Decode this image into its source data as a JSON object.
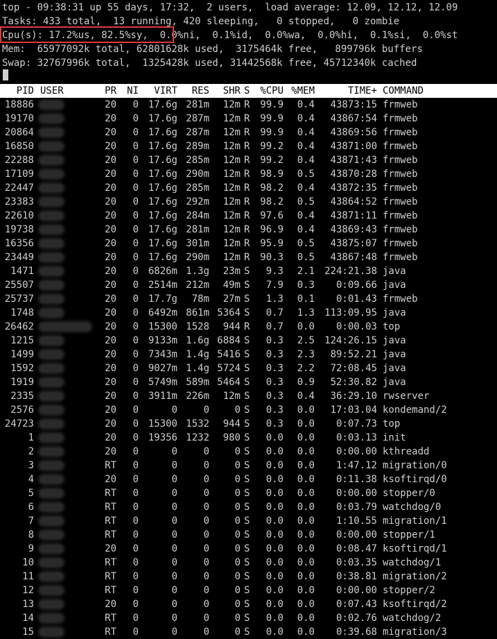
{
  "summary": {
    "line1": "top - 09:38:31 up 55 days, 17:32,  2 users,  load average: 12.09, 12.12, 12.09",
    "line2": "Tasks: 433 total,  13 running, 420 sleeping,   0 stopped,   0 zombie",
    "line3": "Cpu(s): 17.2%us, 82.5%sy,  0.0%ni,  0.1%id,  0.0%wa,  0.0%hi,  0.1%si,  0.0%st",
    "line4": "Mem:  65977092k total, 62801628k used,  3175464k free,   899796k buffers",
    "line5": "Swap: 32767996k total,  1325428k used, 31442568k free, 45712340k cached"
  },
  "columns": {
    "pid": "PID",
    "user": "USER",
    "pr": "PR",
    "ni": "NI",
    "virt": "VIRT",
    "res": "RES",
    "shr": "SHR",
    "s": "S",
    "cpu": "%CPU",
    "mem": "%MEM",
    "time": "TIME+",
    "command": "COMMAND"
  },
  "processes": [
    {
      "pid": "18886",
      "pr": "20",
      "ni": "0",
      "virt": "17.6g",
      "res": "281m",
      "shr": "12m",
      "s": "R",
      "cpu": "99.9",
      "mem": "0.4",
      "time": "43873:15",
      "command": "frmweb"
    },
    {
      "pid": "19170",
      "pr": "20",
      "ni": "0",
      "virt": "17.6g",
      "res": "287m",
      "shr": "12m",
      "s": "R",
      "cpu": "99.9",
      "mem": "0.4",
      "time": "43867:54",
      "command": "frmweb"
    },
    {
      "pid": "20864",
      "pr": "20",
      "ni": "0",
      "virt": "17.6g",
      "res": "287m",
      "shr": "12m",
      "s": "R",
      "cpu": "99.9",
      "mem": "0.4",
      "time": "43869:56",
      "command": "frmweb"
    },
    {
      "pid": "16850",
      "pr": "20",
      "ni": "0",
      "virt": "17.6g",
      "res": "289m",
      "shr": "12m",
      "s": "R",
      "cpu": "99.2",
      "mem": "0.4",
      "time": "43871:00",
      "command": "frmweb"
    },
    {
      "pid": "22288",
      "pr": "20",
      "ni": "0",
      "virt": "17.6g",
      "res": "285m",
      "shr": "12m",
      "s": "R",
      "cpu": "99.2",
      "mem": "0.4",
      "time": "43871:43",
      "command": "frmweb"
    },
    {
      "pid": "17109",
      "pr": "20",
      "ni": "0",
      "virt": "17.6g",
      "res": "290m",
      "shr": "12m",
      "s": "R",
      "cpu": "98.9",
      "mem": "0.5",
      "time": "43870:28",
      "command": "frmweb"
    },
    {
      "pid": "22447",
      "pr": "20",
      "ni": "0",
      "virt": "17.6g",
      "res": "285m",
      "shr": "12m",
      "s": "R",
      "cpu": "98.2",
      "mem": "0.4",
      "time": "43872:35",
      "command": "frmweb"
    },
    {
      "pid": "23383",
      "pr": "20",
      "ni": "0",
      "virt": "17.6g",
      "res": "292m",
      "shr": "12m",
      "s": "R",
      "cpu": "98.2",
      "mem": "0.5",
      "time": "43864:52",
      "command": "frmweb"
    },
    {
      "pid": "22610",
      "pr": "20",
      "ni": "0",
      "virt": "17.6g",
      "res": "284m",
      "shr": "12m",
      "s": "R",
      "cpu": "97.6",
      "mem": "0.4",
      "time": "43871:11",
      "command": "frmweb"
    },
    {
      "pid": "19738",
      "pr": "20",
      "ni": "0",
      "virt": "17.6g",
      "res": "281m",
      "shr": "12m",
      "s": "R",
      "cpu": "96.9",
      "mem": "0.4",
      "time": "43869:43",
      "command": "frmweb"
    },
    {
      "pid": "16356",
      "pr": "20",
      "ni": "0",
      "virt": "17.6g",
      "res": "301m",
      "shr": "12m",
      "s": "R",
      "cpu": "95.9",
      "mem": "0.5",
      "time": "43875:07",
      "command": "frmweb"
    },
    {
      "pid": "23449",
      "pr": "20",
      "ni": "0",
      "virt": "17.6g",
      "res": "290m",
      "shr": "12m",
      "s": "R",
      "cpu": "90.3",
      "mem": "0.5",
      "time": "43867:48",
      "command": "frmweb"
    },
    {
      "pid": "1471",
      "pr": "20",
      "ni": "0",
      "virt": "6826m",
      "res": "1.3g",
      "shr": "23m",
      "s": "S",
      "cpu": "9.3",
      "mem": "2.1",
      "time": "224:21.38",
      "command": "java"
    },
    {
      "pid": "25507",
      "pr": "20",
      "ni": "0",
      "virt": "2514m",
      "res": "212m",
      "shr": "49m",
      "s": "S",
      "cpu": "7.9",
      "mem": "0.3",
      "time": "0:09.66",
      "command": "java"
    },
    {
      "pid": "25737",
      "pr": "20",
      "ni": "0",
      "virt": "17.7g",
      "res": "78m",
      "shr": "27m",
      "s": "S",
      "cpu": "1.3",
      "mem": "0.1",
      "time": "0:01.43",
      "command": "frmweb"
    },
    {
      "pid": "1748",
      "pr": "20",
      "ni": "0",
      "virt": "6492m",
      "res": "861m",
      "shr": "5364",
      "s": "S",
      "cpu": "0.7",
      "mem": "1.3",
      "time": "113:09.95",
      "command": "java"
    },
    {
      "pid": "26462",
      "pr": "20",
      "ni": "0",
      "virt": "15300",
      "res": "1528",
      "shr": "944",
      "s": "R",
      "cpu": "0.7",
      "mem": "0.0",
      "time": "0:00.03",
      "command": "top"
    },
    {
      "pid": "1215",
      "pr": "20",
      "ni": "0",
      "virt": "9133m",
      "res": "1.6g",
      "shr": "6884",
      "s": "S",
      "cpu": "0.3",
      "mem": "2.5",
      "time": "124:26.15",
      "command": "java"
    },
    {
      "pid": "1499",
      "pr": "20",
      "ni": "0",
      "virt": "7343m",
      "res": "1.4g",
      "shr": "5416",
      "s": "S",
      "cpu": "0.3",
      "mem": "2.3",
      "time": "89:52.21",
      "command": "java"
    },
    {
      "pid": "1592",
      "pr": "20",
      "ni": "0",
      "virt": "9027m",
      "res": "1.4g",
      "shr": "5724",
      "s": "S",
      "cpu": "0.3",
      "mem": "2.2",
      "time": "72:08.45",
      "command": "java"
    },
    {
      "pid": "1919",
      "pr": "20",
      "ni": "0",
      "virt": "5749m",
      "res": "589m",
      "shr": "5464",
      "s": "S",
      "cpu": "0.3",
      "mem": "0.9",
      "time": "52:30.82",
      "command": "java"
    },
    {
      "pid": "2335",
      "pr": "20",
      "ni": "0",
      "virt": "3911m",
      "res": "226m",
      "shr": "12m",
      "s": "S",
      "cpu": "0.3",
      "mem": "0.4",
      "time": "36:29.10",
      "command": "rwserver"
    },
    {
      "pid": "2576",
      "pr": "20",
      "ni": "0",
      "virt": "0",
      "res": "0",
      "shr": "0",
      "s": "S",
      "cpu": "0.3",
      "mem": "0.0",
      "time": "17:03.04",
      "command": "kondemand/2"
    },
    {
      "pid": "24723",
      "pr": "20",
      "ni": "0",
      "virt": "15300",
      "res": "1532",
      "shr": "944",
      "s": "S",
      "cpu": "0.3",
      "mem": "0.0",
      "time": "0:07.73",
      "command": "top"
    },
    {
      "pid": "1",
      "pr": "20",
      "ni": "0",
      "virt": "19356",
      "res": "1232",
      "shr": "980",
      "s": "S",
      "cpu": "0.0",
      "mem": "0.0",
      "time": "0:03.13",
      "command": "init"
    },
    {
      "pid": "2",
      "pr": "20",
      "ni": "0",
      "virt": "0",
      "res": "0",
      "shr": "0",
      "s": "S",
      "cpu": "0.0",
      "mem": "0.0",
      "time": "0:00.00",
      "command": "kthreadd"
    },
    {
      "pid": "3",
      "pr": "RT",
      "ni": "0",
      "virt": "0",
      "res": "0",
      "shr": "0",
      "s": "S",
      "cpu": "0.0",
      "mem": "0.0",
      "time": "1:47.12",
      "command": "migration/0"
    },
    {
      "pid": "4",
      "pr": "20",
      "ni": "0",
      "virt": "0",
      "res": "0",
      "shr": "0",
      "s": "S",
      "cpu": "0.0",
      "mem": "0.0",
      "time": "0:11.38",
      "command": "ksoftirqd/0"
    },
    {
      "pid": "5",
      "pr": "RT",
      "ni": "0",
      "virt": "0",
      "res": "0",
      "shr": "0",
      "s": "S",
      "cpu": "0.0",
      "mem": "0.0",
      "time": "0:00.00",
      "command": "stopper/0"
    },
    {
      "pid": "6",
      "pr": "RT",
      "ni": "0",
      "virt": "0",
      "res": "0",
      "shr": "0",
      "s": "S",
      "cpu": "0.0",
      "mem": "0.0",
      "time": "0:03.79",
      "command": "watchdog/0"
    },
    {
      "pid": "7",
      "pr": "RT",
      "ni": "0",
      "virt": "0",
      "res": "0",
      "shr": "0",
      "s": "S",
      "cpu": "0.0",
      "mem": "0.0",
      "time": "1:10.55",
      "command": "migration/1"
    },
    {
      "pid": "8",
      "pr": "RT",
      "ni": "0",
      "virt": "0",
      "res": "0",
      "shr": "0",
      "s": "S",
      "cpu": "0.0",
      "mem": "0.0",
      "time": "0:00.00",
      "command": "stopper/1"
    },
    {
      "pid": "9",
      "pr": "20",
      "ni": "0",
      "virt": "0",
      "res": "0",
      "shr": "0",
      "s": "S",
      "cpu": "0.0",
      "mem": "0.0",
      "time": "0:08.47",
      "command": "ksoftirqd/1"
    },
    {
      "pid": "10",
      "pr": "RT",
      "ni": "0",
      "virt": "0",
      "res": "0",
      "shr": "0",
      "s": "S",
      "cpu": "0.0",
      "mem": "0.0",
      "time": "0:03.35",
      "command": "watchdog/1"
    },
    {
      "pid": "11",
      "pr": "RT",
      "ni": "0",
      "virt": "0",
      "res": "0",
      "shr": "0",
      "s": "S",
      "cpu": "0.0",
      "mem": "0.0",
      "time": "0:38.81",
      "command": "migration/2"
    },
    {
      "pid": "12",
      "pr": "RT",
      "ni": "0",
      "virt": "0",
      "res": "0",
      "shr": "0",
      "s": "S",
      "cpu": "0.0",
      "mem": "0.0",
      "time": "0:00.00",
      "command": "stopper/2"
    },
    {
      "pid": "13",
      "pr": "20",
      "ni": "0",
      "virt": "0",
      "res": "0",
      "shr": "0",
      "s": "S",
      "cpu": "0.0",
      "mem": "0.0",
      "time": "0:07.43",
      "command": "ksoftirqd/2"
    },
    {
      "pid": "14",
      "pr": "RT",
      "ni": "0",
      "virt": "0",
      "res": "0",
      "shr": "0",
      "s": "S",
      "cpu": "0.0",
      "mem": "0.0",
      "time": "0:02.76",
      "command": "watchdog/2"
    },
    {
      "pid": "15",
      "pr": "RT",
      "ni": "0",
      "virt": "0",
      "res": "0",
      "shr": "0",
      "s": "S",
      "cpu": "0.0",
      "mem": "0.0",
      "time": "0:39.68",
      "command": "migration/3"
    }
  ]
}
